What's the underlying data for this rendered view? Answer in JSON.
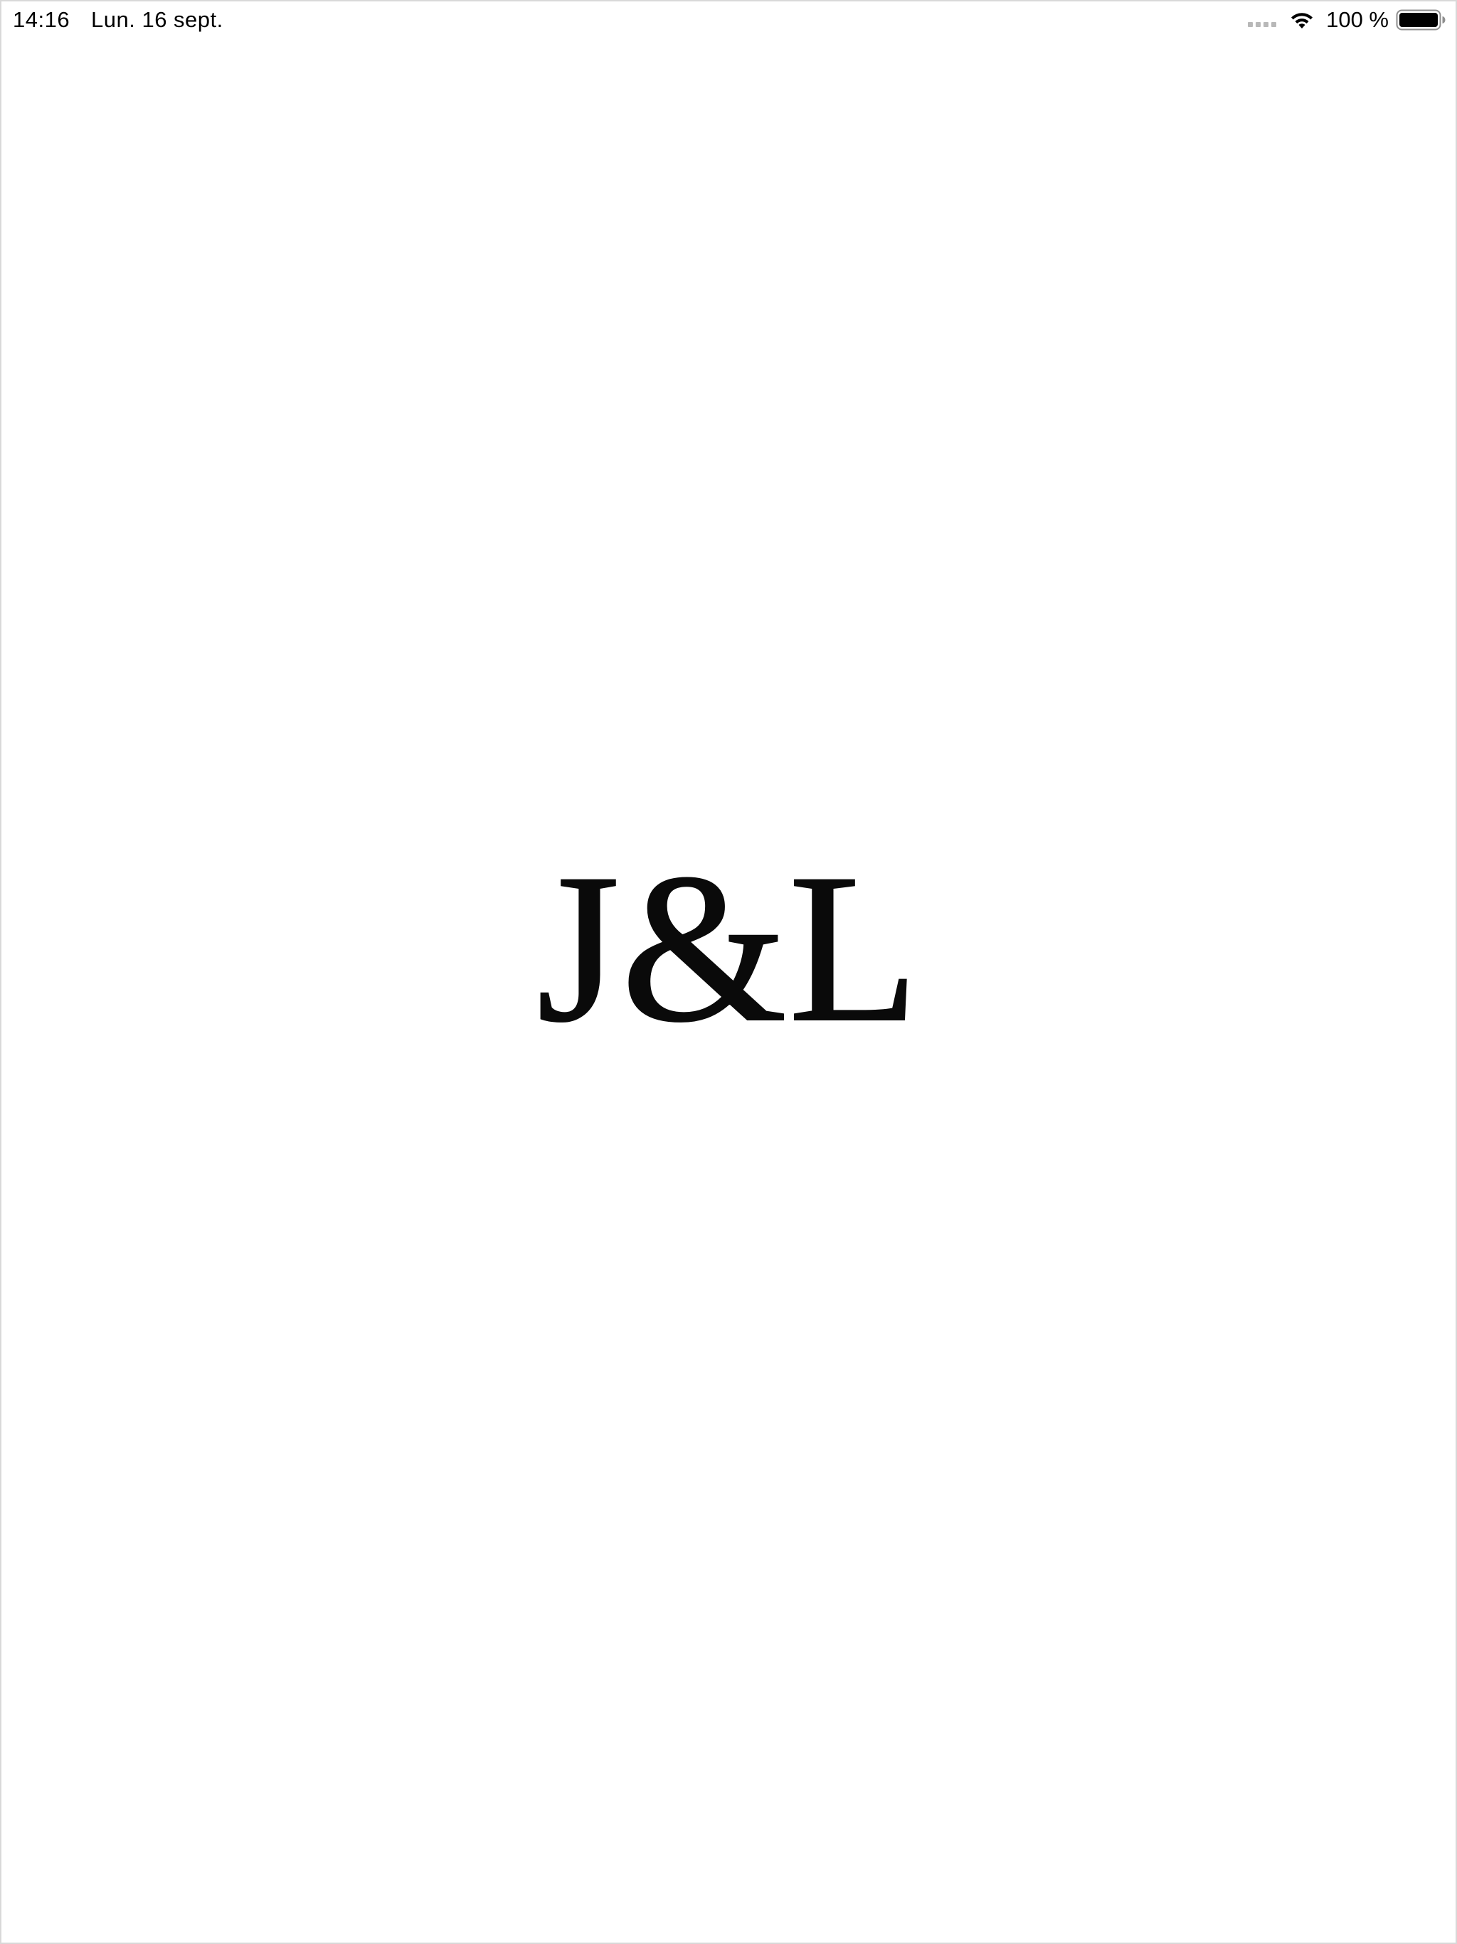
{
  "status_bar": {
    "time": "14:16",
    "date": "Lun. 16 sept.",
    "battery_percent": "100 %",
    "battery_level": 1.0,
    "icons": [
      "cellular-signal-icon",
      "wifi-icon",
      "battery-icon"
    ]
  },
  "splash": {
    "logo_text": "J&L"
  },
  "colors": {
    "background": "#ffffff",
    "text": "#0a0a0a",
    "signal_inactive": "#b8b8b8"
  }
}
